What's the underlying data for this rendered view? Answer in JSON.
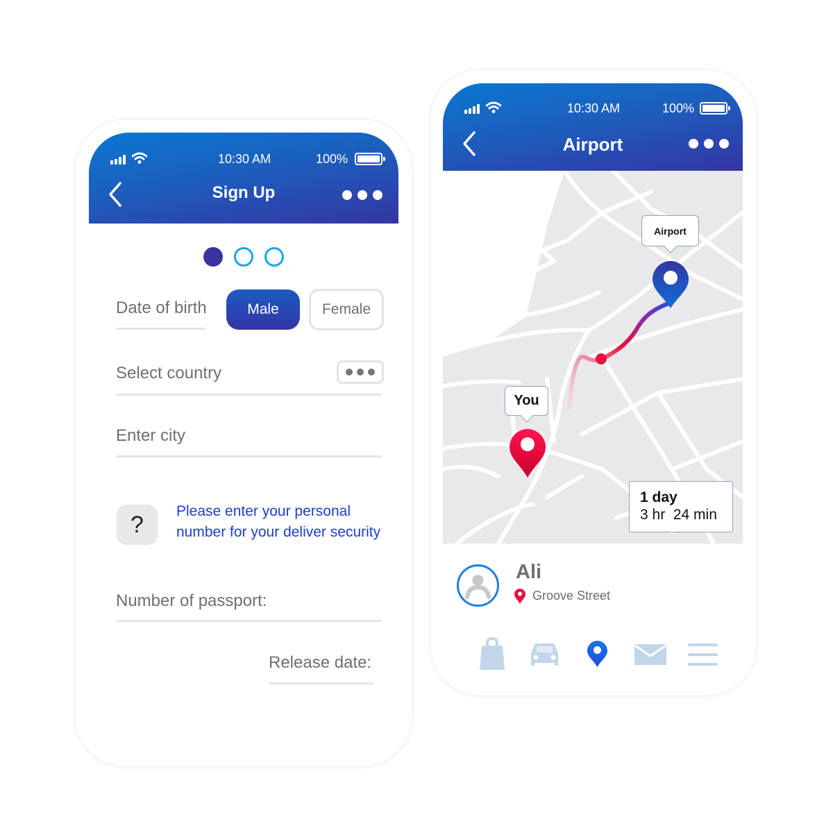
{
  "signup": {
    "status": {
      "time": "10:30 AM",
      "battery": "100%"
    },
    "header": {
      "title": "Sign Up"
    },
    "steps": {
      "total": 3,
      "current": 1
    },
    "date_of_birth_label": "Date of birth",
    "gender": {
      "options": [
        "Male",
        "Female"
      ],
      "selected": "Male"
    },
    "country_label": "Select country",
    "city_label": "Enter city",
    "help": {
      "icon_text": "?",
      "text": "Please enter your personal number for your deliver security"
    },
    "passport_label": "Number of passport:",
    "release_label": "Release date:"
  },
  "route": {
    "status": {
      "time": "10:30 AM",
      "battery": "100%"
    },
    "header": {
      "title": "Airport"
    },
    "map": {
      "destination_label": "Airport",
      "origin_label": "You",
      "eta_days": "1 day",
      "eta_time": "3 hr  24 min"
    },
    "user": {
      "name": "Ali",
      "location": "Groove Street"
    },
    "nav": {
      "items": [
        "shop",
        "car",
        "location",
        "mail",
        "menu"
      ],
      "active": "location"
    }
  },
  "colors": {
    "accent_blue": "#1d5ebd",
    "accent_indigo": "#3535a3",
    "pin_red": "#e8123f",
    "step_ring": "#18a6e8",
    "nav_inactive": "#c2d6ea",
    "nav_active": "#1a74e8"
  }
}
